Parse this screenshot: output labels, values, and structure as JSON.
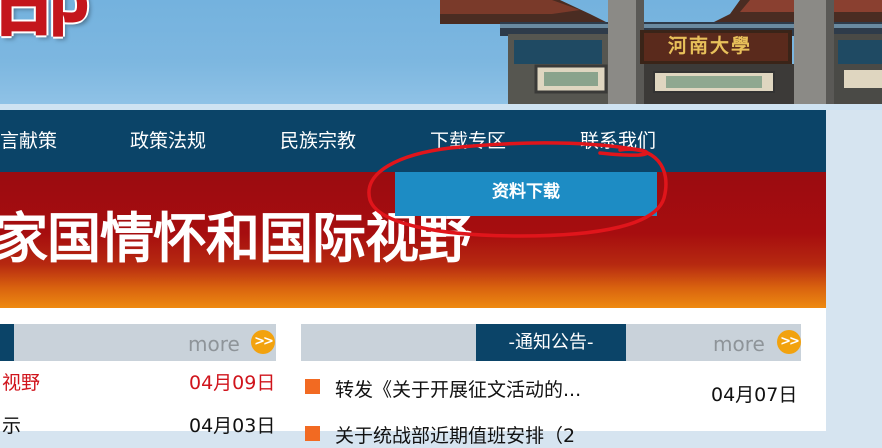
{
  "header": {
    "logo_glyph": "部",
    "gate_plaque": "河南大學",
    "colors": {
      "sky": "#7db7e0",
      "logo_red": "#c4161c"
    }
  },
  "nav": {
    "items": [
      {
        "label": "言献策"
      },
      {
        "label": "政策法规"
      },
      {
        "label": "民族宗教"
      },
      {
        "label": "下载专区"
      },
      {
        "label": "联系我们"
      }
    ],
    "active_dropdown": {
      "parent": "下载专区",
      "items": [
        {
          "label": "资料下载"
        }
      ]
    },
    "colors": {
      "bar": "#0b4468",
      "dropdown": "#1d8cc4"
    }
  },
  "hero": {
    "slogan": "家国情怀和国际视野"
  },
  "annotation": {
    "shape": "red-hand-drawn-circle",
    "color": "#e0151b"
  },
  "left_panel": {
    "more_label": "more",
    "more_icon": "double-chevron-right-icon",
    "rows": [
      {
        "title": "视野",
        "date": "04月09日",
        "highlight": true
      },
      {
        "title": "示",
        "date": "04月03日",
        "highlight": false
      }
    ]
  },
  "right_panel": {
    "title": "-通知公告-",
    "more_label": "more",
    "more_icon": "double-chevron-right-icon",
    "rows": [
      {
        "title": "转发《关于开展征文活动的...",
        "date": "04月07日"
      },
      {
        "title": "关于统战部近期值班安排（2",
        "date": ""
      }
    ]
  }
}
